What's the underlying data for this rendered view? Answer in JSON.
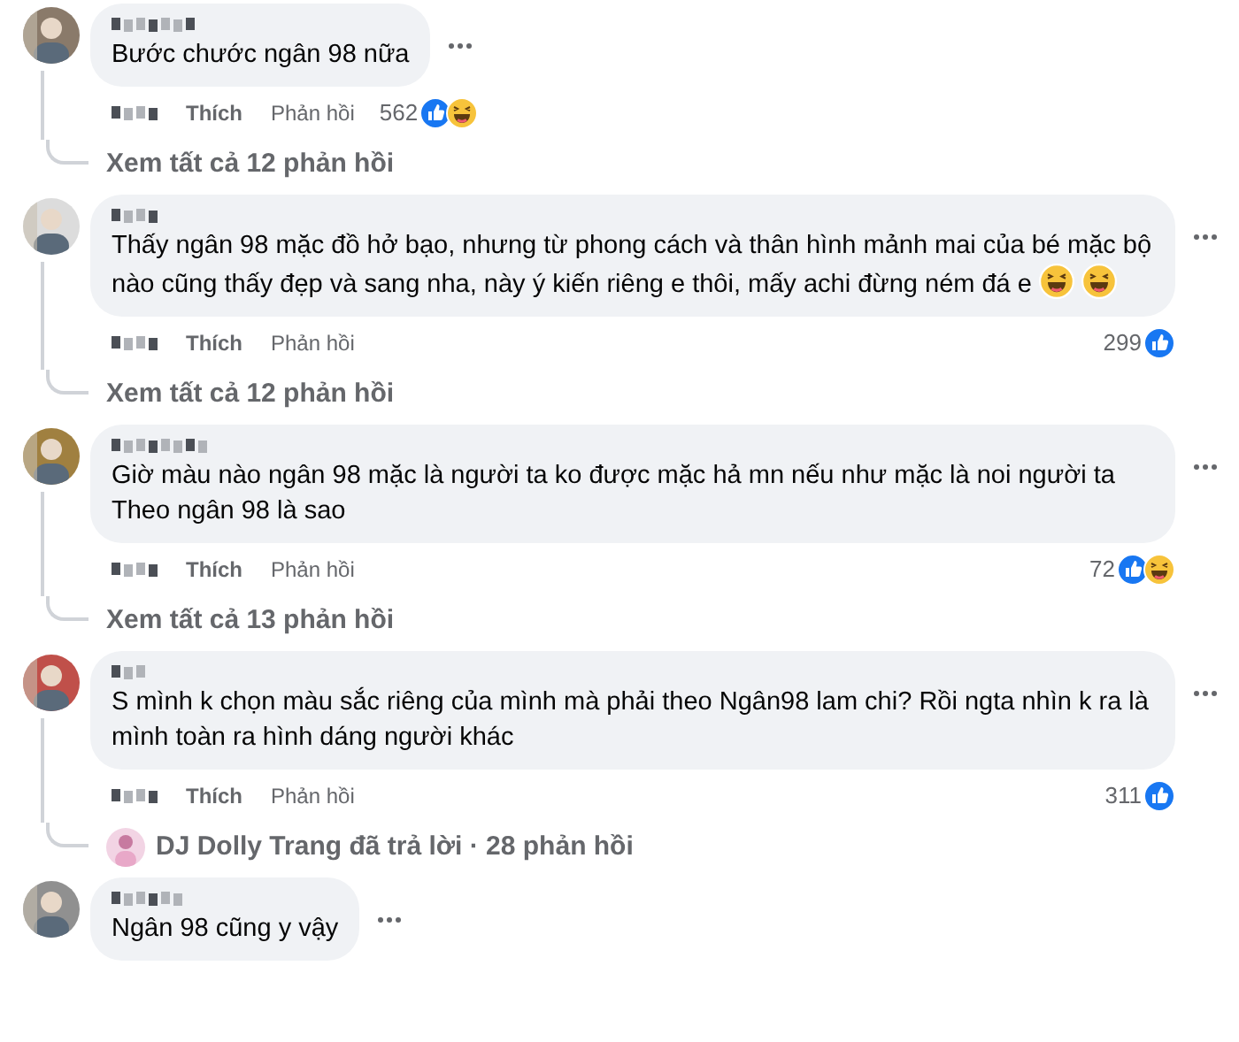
{
  "comments": [
    {
      "text": "Bước chước ngân 98 nữa",
      "actions": [
        "Thích",
        "Phản hồi"
      ],
      "reaction_count": "562",
      "reactions": [
        {
          "kind": "like"
        },
        {
          "kind": "haha"
        }
      ],
      "replies": {
        "text": "Xem tất cả 12 phản hồi"
      }
    },
    {
      "text": "Thấy ngân 98 mặc đồ hở bạo, nhưng từ phong cách và thân hình mảnh mai của bé mặc bộ nào cũng thấy đẹp và sang nha, này ý kiến riêng e thôi, mấy achi đừng ném đá e",
      "trailing_emoji": [
        {
          "kind": "haha"
        },
        {
          "kind": "haha"
        }
      ],
      "actions": [
        "Thích",
        "Phản hồi"
      ],
      "reaction_count": "299",
      "reactions": [
        {
          "kind": "like"
        }
      ],
      "replies": {
        "text": "Xem tất cả 12 phản hồi"
      }
    },
    {
      "text": "Giờ màu nào ngân 98 mặc là người ta ko được mặc hả mn nếu như mặc là noi người ta Theo ngân 98 là sao",
      "actions": [
        "Thích",
        "Phản hồi"
      ],
      "reaction_count": "72",
      "reactions": [
        {
          "kind": "like"
        },
        {
          "kind": "haha"
        }
      ],
      "replies": {
        "text": "Xem tất cả 13 phản hồi"
      }
    },
    {
      "text": "S mình k chọn màu sắc riêng của mình mà phải theo Ngân98 lam chi? Rồi ngta nhìn k ra là mình toàn ra hình dáng người khác",
      "actions": [
        "Thích",
        "Phản hồi"
      ],
      "reaction_count": "311",
      "reactions": [
        {
          "kind": "like"
        }
      ],
      "replies": {
        "kind": "replied",
        "name": "DJ Dolly Trang",
        "text": "đã trả lời · 28 phản hồi"
      }
    },
    {
      "text": "Ngân 98 cũng y vậy"
    }
  ]
}
